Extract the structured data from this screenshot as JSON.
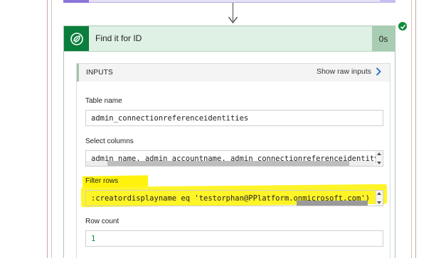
{
  "action": {
    "title": "Find it for ID",
    "duration": "0s",
    "icon": "dataverse-icon",
    "status": "success",
    "accent_color": "#0a7e3c"
  },
  "inputs": {
    "section_title": "INPUTS",
    "show_raw_label": "Show raw inputs"
  },
  "fields": {
    "table_name": {
      "label": "Table name",
      "value": "admin_connectionreferenceidentities"
    },
    "select_columns": {
      "label": "Select columns",
      "value": "admin_name, admin_accountname, admin_connectionreferenceidentityid"
    },
    "filter_rows": {
      "label": "Filter rows",
      "value": ":creatordisplayname eq 'testorphan@PPlatform.onmicrosoft.com')"
    },
    "row_count": {
      "label": "Row count",
      "value": "1"
    }
  },
  "highlight_color": "#fff200"
}
